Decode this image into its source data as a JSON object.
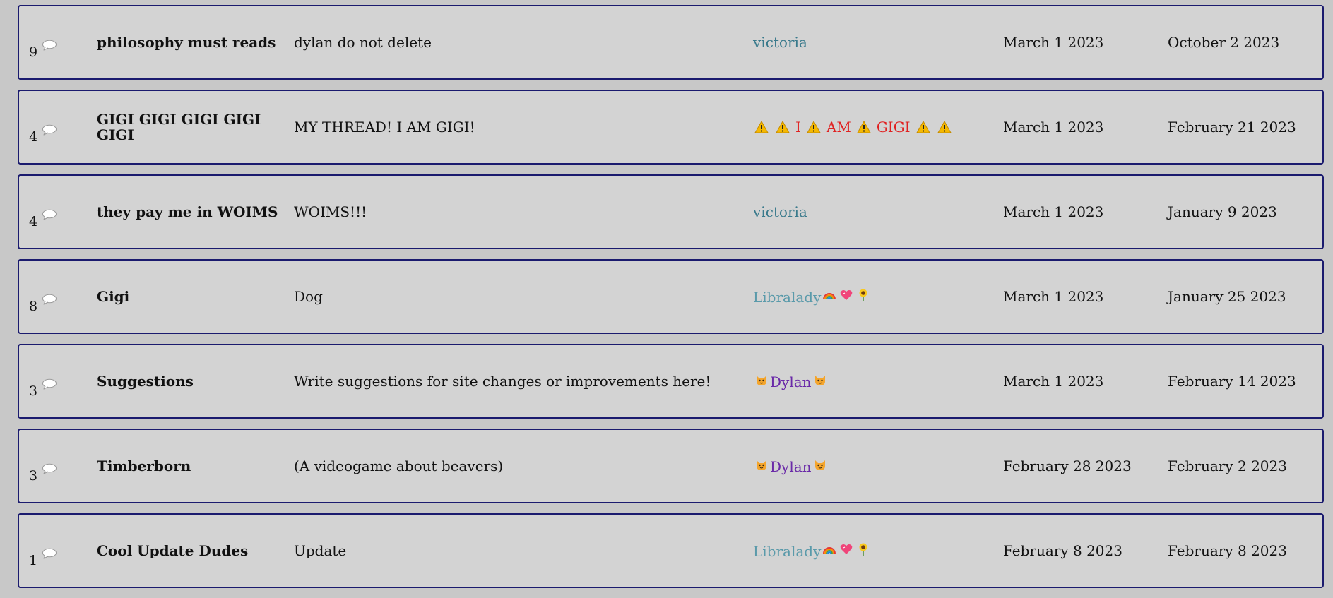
{
  "threads": [
    {
      "count": "9",
      "title": "philosophy must reads",
      "description": "dylan do not delete",
      "author": {
        "style": "plain",
        "parts": [
          "victoria"
        ],
        "color": "#3a7a8c"
      },
      "created": "March 1 2023",
      "updated": "October 2 2023"
    },
    {
      "count": "4",
      "title": "GIGI GIGI GIGI GIGI GIGI",
      "description": "MY THREAD! I AM GIGI!",
      "author": {
        "style": "warning",
        "parts": [
          "I",
          "AM",
          "GIGI"
        ],
        "color": "#e02020"
      },
      "created": "March 1 2023",
      "updated": "February 21 2023"
    },
    {
      "count": "4",
      "title": "they pay me in WOIMS",
      "description": "WOIMS!!!",
      "author": {
        "style": "plain",
        "parts": [
          "victoria"
        ],
        "color": "#3a7a8c"
      },
      "created": "March 1 2023",
      "updated": "January 9 2023"
    },
    {
      "count": "8",
      "title": "Gigi",
      "description": "Dog",
      "author": {
        "style": "libra",
        "parts": [
          "Libralady"
        ],
        "color": "#5a9aaa"
      },
      "created": "March 1 2023",
      "updated": "January 25 2023"
    },
    {
      "count": "3",
      "title": "Suggestions",
      "description": "Write suggestions for site changes or improvements here!",
      "author": {
        "style": "cat",
        "parts": [
          "Dylan"
        ],
        "color": "#6a2aa8"
      },
      "created": "March 1 2023",
      "updated": "February 14 2023"
    },
    {
      "count": "3",
      "title": "Timberborn",
      "description": "(A videogame about beavers)",
      "author": {
        "style": "cat",
        "parts": [
          "Dylan"
        ],
        "color": "#6a2aa8"
      },
      "created": "February 28 2023",
      "updated": "February 2 2023"
    },
    {
      "count": "1",
      "title": "Cool Update Dudes",
      "description": "Update",
      "author": {
        "style": "libra",
        "parts": [
          "Libralady"
        ],
        "color": "#5a9aaa"
      },
      "created": "February 8 2023",
      "updated": "February 8 2023"
    }
  ],
  "icons": {
    "reply_count": "speech-bubble-icon",
    "warning": "warning-icon",
    "cat": "cat-face-icon",
    "rainbow": "rainbow-icon",
    "heart": "heart-icon",
    "sunflower": "sunflower-icon"
  }
}
